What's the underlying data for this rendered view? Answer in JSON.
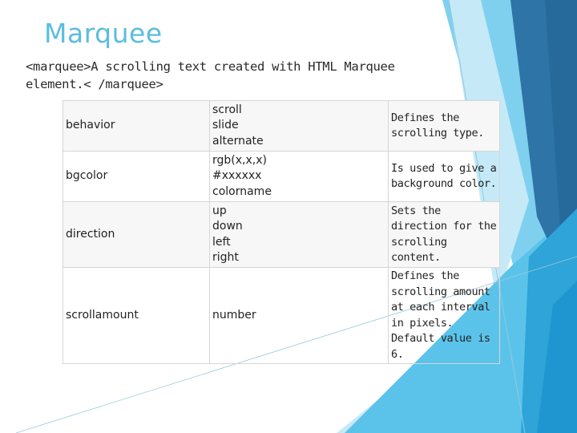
{
  "slide": {
    "title": "Marquee",
    "subtitle": "<marquee>A scrolling text created with HTML Marquee element.< /marquee>",
    "accent_color": "#5bbde0"
  },
  "table": {
    "rows": [
      {
        "attribute": "behavior",
        "values": [
          "scroll",
          "slide",
          "alternate"
        ],
        "description": "Defines the scrolling type."
      },
      {
        "attribute": "bgcolor",
        "values": [
          "rgb(x,x,x)",
          "#xxxxxx",
          "colorname"
        ],
        "description": "Is used to give a background color."
      },
      {
        "attribute": "direction",
        "values": [
          "up",
          "down",
          "left",
          "right"
        ],
        "description": "Sets the direction for the scrolling content."
      },
      {
        "attribute": "scrollamount",
        "values": [
          "number"
        ],
        "description": "Defines the scrolling amount at each interval in pixels. Default value is 6."
      }
    ]
  }
}
